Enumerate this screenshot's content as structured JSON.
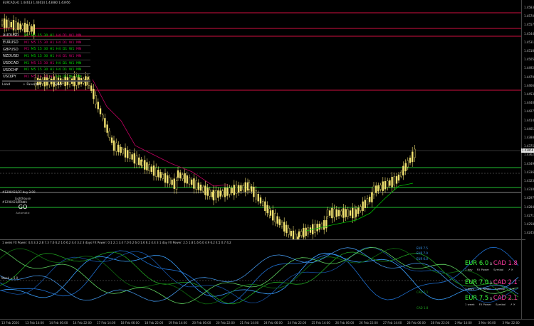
{
  "header": {
    "symbol_info": "EURCAD,H1  1.44613 1.44614 1.43880 1.43956"
  },
  "price_axis": [
    "1.45835",
    "1.45705",
    "1.45575",
    "1.45445",
    "1.45315",
    "1.45185",
    "1.45055",
    "1.44925",
    "1.44795",
    "1.44665",
    "1.44535",
    "1.44405",
    "1.44275",
    "1.44145",
    "1.44015",
    "1.43885",
    "1.43755",
    "1.43625",
    "1.43495",
    "1.43365",
    "1.43235",
    "1.43105",
    "1.42975",
    "1.42845",
    "1.42715",
    "1.42585",
    "1.42455"
  ],
  "current_price": "1.43956",
  "symbols": [
    {
      "name": "AUDUSD",
      "tf": [
        {
          "t": "M1",
          "c": "#00e000"
        },
        {
          "t": "M5",
          "c": "#00e000"
        },
        {
          "t": "15",
          "c": "#00e000"
        },
        {
          "t": "30",
          "c": "#00e000"
        },
        {
          "t": "H1",
          "c": "#00e000"
        },
        {
          "t": "H4",
          "c": "#e0007a"
        },
        {
          "t": "D1",
          "c": "#e0007a"
        },
        {
          "t": "W1",
          "c": "#e0007a"
        },
        {
          "t": "MN",
          "c": "#e0007a"
        }
      ]
    },
    {
      "name": "EURUSD",
      "tf": [
        {
          "t": "M1",
          "c": "#e0007a"
        },
        {
          "t": "M5",
          "c": "#e0007a"
        },
        {
          "t": "15",
          "c": "#e0007a"
        },
        {
          "t": "30",
          "c": "#e0007a"
        },
        {
          "t": "H1",
          "c": "#e0007a"
        },
        {
          "t": "H4",
          "c": "#e0007a"
        },
        {
          "t": "D1",
          "c": "#e0007a"
        },
        {
          "t": "W1",
          "c": "#e0007a"
        },
        {
          "t": "MN",
          "c": "#e0007a"
        }
      ]
    },
    {
      "name": "GBPUSD",
      "tf": [
        {
          "t": "M1",
          "c": "#e0007a"
        },
        {
          "t": "M5",
          "c": "#00e000"
        },
        {
          "t": "15",
          "c": "#00e000"
        },
        {
          "t": "30",
          "c": "#00e000"
        },
        {
          "t": "H1",
          "c": "#00e000"
        },
        {
          "t": "H4",
          "c": "#00e000"
        },
        {
          "t": "D1",
          "c": "#00e000"
        },
        {
          "t": "W1",
          "c": "#00e000"
        },
        {
          "t": "MN",
          "c": "#e0007a"
        }
      ]
    },
    {
      "name": "NZDUSD",
      "tf": [
        {
          "t": "M1",
          "c": "#00e000"
        },
        {
          "t": "M5",
          "c": "#00e000"
        },
        {
          "t": "15",
          "c": "#00e000"
        },
        {
          "t": "30",
          "c": "#00e000"
        },
        {
          "t": "H1",
          "c": "#00e000"
        },
        {
          "t": "H4",
          "c": "#e0007a"
        },
        {
          "t": "D1",
          "c": "#e0007a"
        },
        {
          "t": "W1",
          "c": "#e0007a"
        },
        {
          "t": "MN",
          "c": "#e0007a"
        }
      ]
    },
    {
      "name": "USDCAD",
      "tf": [
        {
          "t": "M1",
          "c": "#00e000"
        },
        {
          "t": "M5",
          "c": "#e0007a"
        },
        {
          "t": "15",
          "c": "#e0007a"
        },
        {
          "t": "30",
          "c": "#e0007a"
        },
        {
          "t": "H1",
          "c": "#e0007a"
        },
        {
          "t": "H4",
          "c": "#00e000"
        },
        {
          "t": "D1",
          "c": "#00e000"
        },
        {
          "t": "W1",
          "c": "#00e000"
        },
        {
          "t": "MN",
          "c": "#00e000"
        }
      ]
    },
    {
      "name": "USDCHF",
      "tf": [
        {
          "t": "M1",
          "c": "#00e000"
        },
        {
          "t": "M5",
          "c": "#00e000"
        },
        {
          "t": "15",
          "c": "#00e000"
        },
        {
          "t": "30",
          "c": "#00e000"
        },
        {
          "t": "H1",
          "c": "#00e000"
        },
        {
          "t": "H4",
          "c": "#00e000"
        },
        {
          "t": "D1",
          "c": "#00e000"
        },
        {
          "t": "W1",
          "c": "#00e000"
        },
        {
          "t": "MN",
          "c": "#00e000"
        }
      ]
    },
    {
      "name": "USDJPY",
      "tf": [
        {
          "t": "M1",
          "c": "#e0007a"
        },
        {
          "t": "M5",
          "c": "#e0007a"
        },
        {
          "t": "15",
          "c": "#e0007a"
        },
        {
          "t": "30",
          "c": "#e0007a"
        },
        {
          "t": "H1",
          "c": "#e0007a"
        },
        {
          "t": "H4",
          "c": "#00e000"
        },
        {
          "t": "D1",
          "c": "#00e000"
        },
        {
          "t": "W1",
          "c": "#00e000"
        },
        {
          "t": "MN",
          "c": "#00e000"
        }
      ]
    }
  ],
  "panel_buttons": {
    "load": "Load",
    "favorites": "Favorites",
    "save": "Save"
  },
  "lighthouse": {
    "title": "Lighthouse Check",
    "go": "GO",
    "status": "Automatic"
  },
  "line_labels": {
    "upper": "#1298423/27 buy 2.00",
    "lower": "#1298423/27 tl"
  },
  "indicator": {
    "header": "1 week FX Power: 4.4 3.3 2.8 7.3 7.6 6.2 1.6 6.2 4.4 3.2   3 days FX Power: 0.1 2.1 3.4 7.0 6.2 6.0 1.6 6.2 4.4 3   1 day FX Power: 2.5 1.8 1.6 6.0 4.9 6.2 4.5 0.7 4.2",
    "week_label": "Week = 3.0",
    "series_labels": [
      {
        "text": "EUR 7.5",
        "c": "#3aa0ff"
      },
      {
        "text": "EUR 7.0",
        "c": "#3aa0ff"
      },
      {
        "text": "EUR 6.0",
        "c": "#3aa0ff"
      },
      {
        "text": "CAD 2.1",
        "c": "#20a020"
      },
      {
        "text": "CAD 1.8",
        "c": "#20a020"
      }
    ],
    "powers": [
      {
        "base": "EUR 6.0",
        "quote": "CAD 1.8",
        "period": "1 day",
        "fx": "FX Power",
        "symbol": "Symbol"
      },
      {
        "base": "EUR 7.0",
        "quote": "CAD 2.1",
        "period": "3 days",
        "fx": "FX Power",
        "symbol": "Symbol"
      },
      {
        "base": "EUR 7.5",
        "quote": "CAD 2.1",
        "period": "1 week",
        "fx": "FX Power",
        "symbol": "Symbol"
      }
    ]
  },
  "time_axis": [
    "13 Feb 2020",
    "13 Feb 14:00",
    "14 Feb 06:00",
    "14 Feb 22:00",
    "17 Feb 14:00",
    "18 Feb 06:00",
    "18 Feb 22:00",
    "19 Feb 14:00",
    "20 Feb 06:00",
    "20 Feb 22:00",
    "21 Feb 14:00",
    "24 Feb 06:00",
    "24 Feb 22:00",
    "25 Feb 14:00",
    "26 Feb 06:00",
    "26 Feb 22:00",
    "27 Feb 14:00",
    "28 Feb 06:00",
    "28 Feb 22:00",
    "2 Mar 14:00",
    "3 Mar 06:00",
    "3 Mar 22:00"
  ],
  "colors": {
    "bull": "#f0e070",
    "bear": "#ffffff",
    "resistance": "#d01040",
    "support": "#20c030",
    "stop": "#a01040",
    "sar_up": "#00c000",
    "sar_down": "#c00060"
  }
}
